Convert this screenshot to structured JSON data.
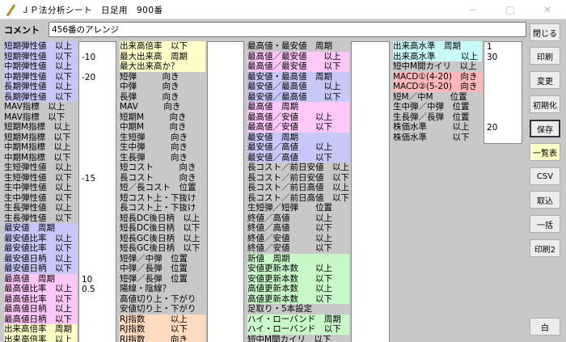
{
  "window": {
    "title": "ＪＰ法分析シート　日足用　900番",
    "minimize": "−",
    "maximize": "□",
    "close": "✕"
  },
  "comment": {
    "label": "コメント",
    "value": "456番のアレンジ"
  },
  "colors": {
    "blue": "#c8c8f8",
    "yellow": "#ffffc8",
    "pink": "#ffc8f8",
    "green": "#c8f8c8",
    "cyan": "#c8f8f8",
    "peach": "#ffdcc0",
    "salmon": "#ffb8b8",
    "white": "#ffffff",
    "gray": "#c8c8c8"
  },
  "col1": [
    {
      "t": "短期弾性値　以上",
      "c": "blue"
    },
    {
      "t": "短期弾性値　以下",
      "c": "blue"
    },
    {
      "t": "中期弾性値　以上",
      "c": "blue"
    },
    {
      "t": "中期弾性値　以下",
      "c": "blue"
    },
    {
      "t": "長期弾性値　以上",
      "c": "blue"
    },
    {
      "t": "長期弾性値　以下",
      "c": "blue"
    },
    {
      "t": "MAV指標　以上",
      "c": "gray"
    },
    {
      "t": "MAV指標　以下",
      "c": "gray"
    },
    {
      "t": "短期M指標　以上",
      "c": "gray"
    },
    {
      "t": "短期M指標　以下",
      "c": "gray"
    },
    {
      "t": "中期M指標　以上",
      "c": "gray"
    },
    {
      "t": "中期M指標　以下",
      "c": "gray"
    },
    {
      "t": "生短弾性値　以上",
      "c": "gray"
    },
    {
      "t": "生短弾性値　以下",
      "c": "gray"
    },
    {
      "t": "生中弾性値　以上",
      "c": "gray"
    },
    {
      "t": "生中弾性値　以下",
      "c": "gray"
    },
    {
      "t": "生長弾性値　以上",
      "c": "gray"
    },
    {
      "t": "生長弾性値　以下",
      "c": "gray"
    },
    {
      "t": "最安値　周期",
      "c": "blue"
    },
    {
      "t": "最安値比率　以上",
      "c": "blue"
    },
    {
      "t": "最安値比率　以下",
      "c": "blue"
    },
    {
      "t": "最安値日柄　以上",
      "c": "blue"
    },
    {
      "t": "最安値日柄　以下",
      "c": "blue"
    },
    {
      "t": "最高値　周期",
      "c": "pink"
    },
    {
      "t": "最高値比率　以上",
      "c": "pink"
    },
    {
      "t": "最高値比率　以下",
      "c": "pink"
    },
    {
      "t": "最高値日柄　以上",
      "c": "pink"
    },
    {
      "t": "最高値日柄　以下",
      "c": "pink"
    },
    {
      "t": "出来高倍率　周期",
      "c": "yellow"
    },
    {
      "t": "出来高倍率　以上",
      "c": "yellow"
    }
  ],
  "col1_values": [
    "",
    "-10",
    "",
    "-20",
    "",
    "",
    "",
    "",
    "",
    "",
    "",
    "",
    "",
    "-15",
    "",
    "",
    "",
    "",
    "",
    "",
    "",
    "",
    "",
    "10",
    "0.5",
    "",
    "",
    "",
    "",
    ""
  ],
  "col2": [
    {
      "t": "出来高倍率　以下",
      "c": "yellow"
    },
    {
      "t": "最大出来高　周期",
      "c": "yellow"
    },
    {
      "t": "最大出来高か？",
      "c": "yellow"
    },
    {
      "t": "短弾　　　向き",
      "c": "gray"
    },
    {
      "t": "中弾　　　向き",
      "c": "gray"
    },
    {
      "t": "長弾　　　向き",
      "c": "gray"
    },
    {
      "t": "MAV　　　向き",
      "c": "gray"
    },
    {
      "t": "短期M　　　向き",
      "c": "gray"
    },
    {
      "t": "中期M　　　向き",
      "c": "gray"
    },
    {
      "t": "生短弾　　　向き",
      "c": "gray"
    },
    {
      "t": "生中弾　　　向き",
      "c": "gray"
    },
    {
      "t": "生長弾　　　向き",
      "c": "gray"
    },
    {
      "t": "短コスト　　　向き",
      "c": "gray"
    },
    {
      "t": "長コスト　　　向き",
      "c": "gray"
    },
    {
      "t": "短／長コスト　位置",
      "c": "gray"
    },
    {
      "t": "短コスト上・下抜け",
      "c": "gray"
    },
    {
      "t": "長コスト上・下抜け",
      "c": "gray"
    },
    {
      "t": "短長DC後日柄　以上",
      "c": "gray"
    },
    {
      "t": "短長DC後日柄　以下",
      "c": "gray"
    },
    {
      "t": "短長GC後日柄　以上",
      "c": "gray"
    },
    {
      "t": "短長GC後日柄　以下",
      "c": "gray"
    },
    {
      "t": "短弾／中弾　位置",
      "c": "gray"
    },
    {
      "t": "中弾／長弾　位置",
      "c": "gray"
    },
    {
      "t": "短弾／長弾　位置",
      "c": "gray"
    },
    {
      "t": "陽線・陰線？",
      "c": "gray"
    },
    {
      "t": "高値切り上・下がり",
      "c": "gray"
    },
    {
      "t": "安値切り上・下がり",
      "c": "gray"
    },
    {
      "t": "RJ指数　　　以上",
      "c": "peach"
    },
    {
      "t": "RJ指数　　　以下",
      "c": "peach"
    },
    {
      "t": "RJ指数　　　向き",
      "c": "peach"
    }
  ],
  "col3": [
    {
      "t": "最高値・最安値　周期",
      "c": "gray"
    },
    {
      "t": "最高値／最安値　　以上",
      "c": "pink"
    },
    {
      "t": "最高値／最安値　　以下",
      "c": "pink"
    },
    {
      "t": "最安値・最高値　周期",
      "c": "blue"
    },
    {
      "t": "最安値／最高値　　以上",
      "c": "blue"
    },
    {
      "t": "最安値／最高値　　以下",
      "c": "blue"
    },
    {
      "t": "最高値　周期",
      "c": "pink"
    },
    {
      "t": "最高値／安値　　以上",
      "c": "pink"
    },
    {
      "t": "最高値／安値　　以下",
      "c": "pink"
    },
    {
      "t": "最安値　周期",
      "c": "blue"
    },
    {
      "t": "最安値／高値　　以上",
      "c": "blue"
    },
    {
      "t": "最安値／高値　　以下",
      "c": "blue"
    },
    {
      "t": "長コスト／前日安値　以上",
      "c": "gray"
    },
    {
      "t": "長コスト／前日安値　以下",
      "c": "gray"
    },
    {
      "t": "長コスト／前日高値　以上",
      "c": "gray"
    },
    {
      "t": "長コスト／前日高値　以下",
      "c": "gray"
    },
    {
      "t": "生短弾／短弾　　位置",
      "c": "gray"
    },
    {
      "t": "終値／高値　　　以上",
      "c": "gray"
    },
    {
      "t": "終値／高値　　　以下",
      "c": "gray"
    },
    {
      "t": "終値／安値　　　以上",
      "c": "gray"
    },
    {
      "t": "終値／安値　　　以下",
      "c": "gray"
    },
    {
      "t": "新値　周期",
      "c": "green"
    },
    {
      "t": "安値更新本数　　以上",
      "c": "green"
    },
    {
      "t": "安値更新本数　　以下",
      "c": "green"
    },
    {
      "t": "高値更新本数　　以上",
      "c": "green"
    },
    {
      "t": "高値更新本数　　以下",
      "c": "green"
    },
    {
      "t": "足取り・5本設定",
      "c": "gray"
    },
    {
      "t": "ハイ・ローバンド　周期",
      "c": "green"
    },
    {
      "t": "ハイ・ローバンド　以下",
      "c": "green"
    },
    {
      "t": "短中M間カイリ　以下",
      "c": "gray"
    }
  ],
  "col4": [
    {
      "t": "出来高水準　周期",
      "c": "cyan"
    },
    {
      "t": "出来高水準　　　以上",
      "c": "cyan"
    },
    {
      "t": "短中M間カイリ　以上",
      "c": "gray"
    },
    {
      "t": "MACD①(4-20)　向き",
      "c": "salmon"
    },
    {
      "t": "MACD②(5-20)　向き",
      "c": "salmon"
    },
    {
      "t": "短M／中M　　位置",
      "c": "gray"
    },
    {
      "t": "生中弾／中弾　位置",
      "c": "gray"
    },
    {
      "t": "生長弾／長弾　位置",
      "c": "gray"
    },
    {
      "t": "株価水準　　　以上",
      "c": "gray"
    },
    {
      "t": "株価水準　　　以下",
      "c": "gray"
    }
  ],
  "col4_values": [
    "1",
    "30",
    "",
    "",
    "",
    "",
    "",
    "",
    "20",
    ""
  ],
  "buttons": [
    {
      "label": "閉じる",
      "name": "close-button",
      "style": ""
    },
    {
      "label": "印刷",
      "name": "print-button",
      "style": ""
    },
    {
      "label": "変更",
      "name": "change-button",
      "style": ""
    },
    {
      "label": "初期化",
      "name": "initialize-button",
      "style": ""
    },
    {
      "label": "保存",
      "name": "save-button",
      "style": "focus"
    },
    {
      "label": "一覧表",
      "name": "list-button",
      "style": "yellow"
    },
    {
      "label": "CSV",
      "name": "csv-button",
      "style": ""
    },
    {
      "label": "取込",
      "name": "import-button",
      "style": ""
    },
    {
      "label": "一括",
      "name": "batch-button",
      "style": ""
    },
    {
      "label": "印刷2",
      "name": "print2-button",
      "style": ""
    },
    {
      "label": "白",
      "name": "white-button",
      "style": ""
    }
  ]
}
